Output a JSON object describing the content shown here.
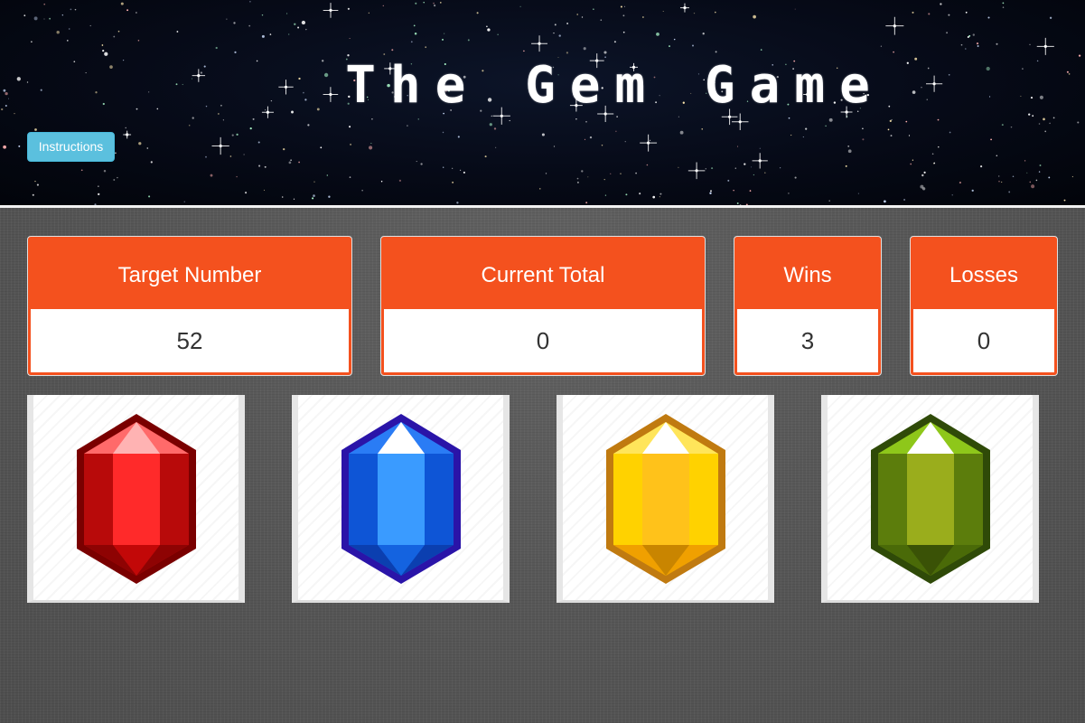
{
  "header": {
    "title": "The Gem Game",
    "instructions_label": "Instructions"
  },
  "stats": {
    "target": {
      "label": "Target Number",
      "value": "52"
    },
    "total": {
      "label": "Current Total",
      "value": "0"
    },
    "wins": {
      "label": "Wins",
      "value": "3"
    },
    "losses": {
      "label": "Losses",
      "value": "0"
    }
  },
  "colors": {
    "panel_accent": "#f4511e",
    "button_info": "#5bc0de",
    "gem_red": "#e81414",
    "gem_blue": "#1a6ff0",
    "gem_yellow": "#f5c400",
    "gem_green": "#7a9a12"
  },
  "gems": [
    {
      "name": "red-gem-icon"
    },
    {
      "name": "blue-gem-icon"
    },
    {
      "name": "yellow-gem-icon"
    },
    {
      "name": "green-gem-icon"
    }
  ]
}
